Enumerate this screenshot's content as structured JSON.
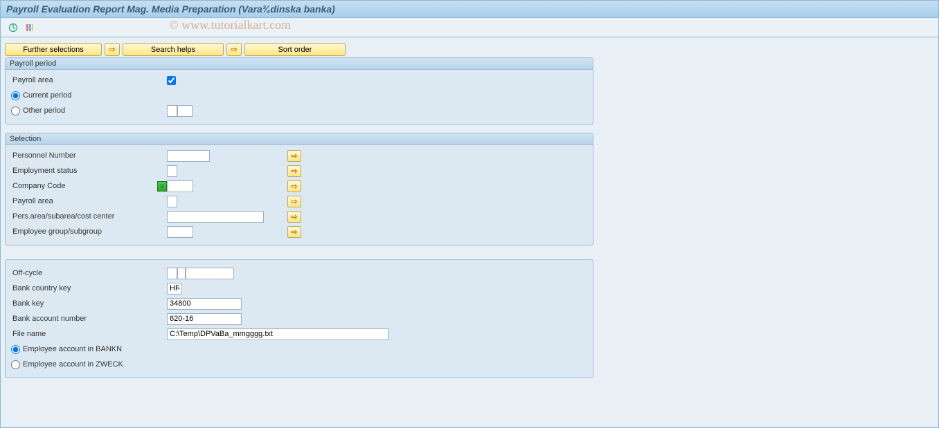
{
  "title": "Payroll Evaluation Report Mag. Media Preparation (Vara¾dinska banka)",
  "watermark": "© www.tutorialkart.com",
  "toolbar_buttons": {
    "further_selections": "Further selections",
    "search_helps": "Search helps",
    "sort_order": "Sort order"
  },
  "payroll_period": {
    "header": "Payroll period",
    "payroll_area": "Payroll area",
    "current_period": "Current period",
    "other_period": "Other period"
  },
  "selection": {
    "header": "Selection",
    "personnel_number": "Personnel Number",
    "employment_status": "Employment status",
    "company_code": "Company Code",
    "payroll_area": "Payroll area",
    "pers_area": "Pers.area/subarea/cost center",
    "employee_group": "Employee group/subgroup"
  },
  "details": {
    "off_cycle": "Off-cycle",
    "bank_country_key": "Bank country key",
    "bank_country_key_value": "HR",
    "bank_key": "Bank key",
    "bank_key_value": "34800",
    "bank_account_number": "Bank account number",
    "bank_account_number_value": "620-16",
    "file_name": "File name",
    "file_name_value": "C:\\Temp\\DPVaBa_mmgggg.txt",
    "employee_bankn": "Employee account in BANKN",
    "employee_zweck": "Employee account in ZWECK"
  }
}
